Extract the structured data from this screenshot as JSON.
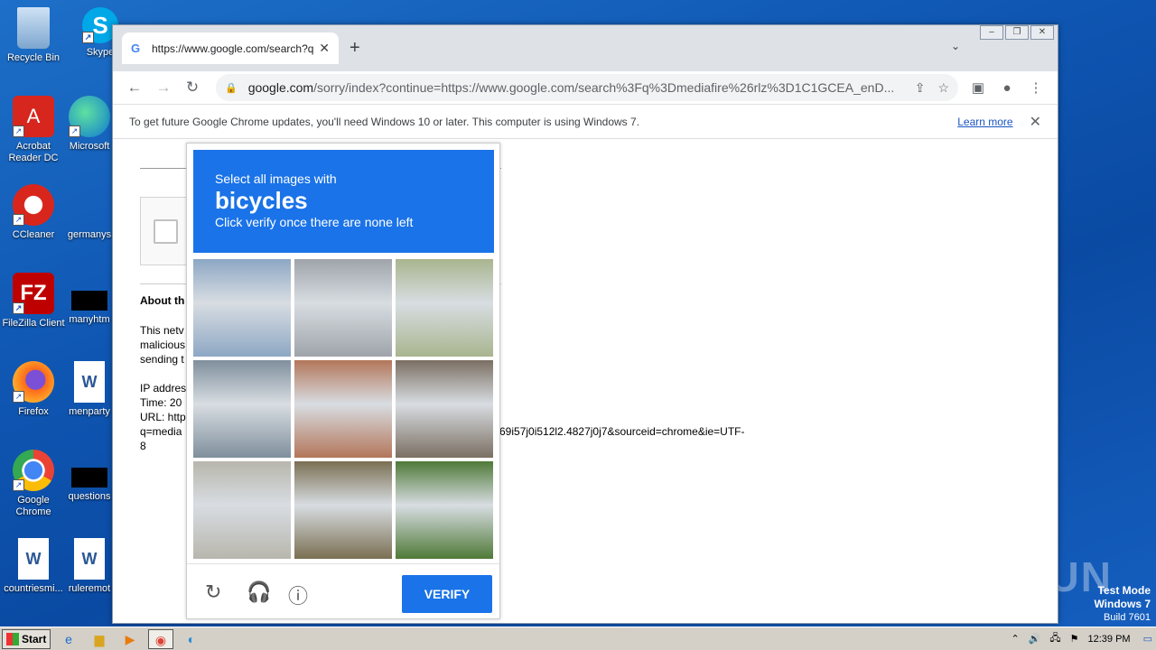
{
  "desktop": {
    "icons": [
      {
        "label": "Recycle Bin"
      },
      {
        "label": "Skype"
      },
      {
        "label": "Acrobat Reader DC"
      },
      {
        "label": "Microsoft"
      },
      {
        "label": "CCleaner"
      },
      {
        "label": "germanys"
      },
      {
        "label": "FileZilla Client"
      },
      {
        "label": "manyhtm"
      },
      {
        "label": "Firefox"
      },
      {
        "label": "menparty"
      },
      {
        "label": "Google Chrome"
      },
      {
        "label": "questions"
      },
      {
        "label": "countriesmi..."
      },
      {
        "label": "ruleremot"
      }
    ]
  },
  "browser": {
    "tab_title": "https://www.google.com/search?q=",
    "url_host": "google.com",
    "url_rest": "/sorry/index?continue=https://www.google.com/search%3Fq%3Dmediafire%26rlz%3D1C1GCEA_enD...",
    "infobar": {
      "message": "To get future Google Chrome updates, you'll need Windows 10 or later. This computer is using Windows 7.",
      "learn_more": "Learn more"
    }
  },
  "page": {
    "about_heading": "About th",
    "para1": [
      "This netv",
      "malicious",
      "sending t"
    ],
    "ip_lines": [
      "IP addres",
      "Time: 20",
      "URL: http",
      "q=media"
    ],
    "url_tail": "69i57j0i512l2.4827j0j7&sourceid=chrome&ie=UTF-",
    "url_tail2": "8"
  },
  "captcha": {
    "line1": "Select all images with",
    "keyword": "bicycles",
    "line3": "Click verify once there are none left",
    "verify_label": "VERIFY",
    "tile_colors": [
      "#8da7c4",
      "#9ea4aa",
      "#a9b58f",
      "#7f8f9c",
      "#b3765a",
      "#7b6f63",
      "#b8b6ad",
      "#7a6f52",
      "#4f7a38"
    ]
  },
  "watermark": "ANY RUN",
  "testmode": {
    "l1": "Test Mode",
    "l2": "Windows 7",
    "l3": "Build 7601"
  },
  "taskbar": {
    "start": "Start",
    "clock": "12:39 PM"
  }
}
